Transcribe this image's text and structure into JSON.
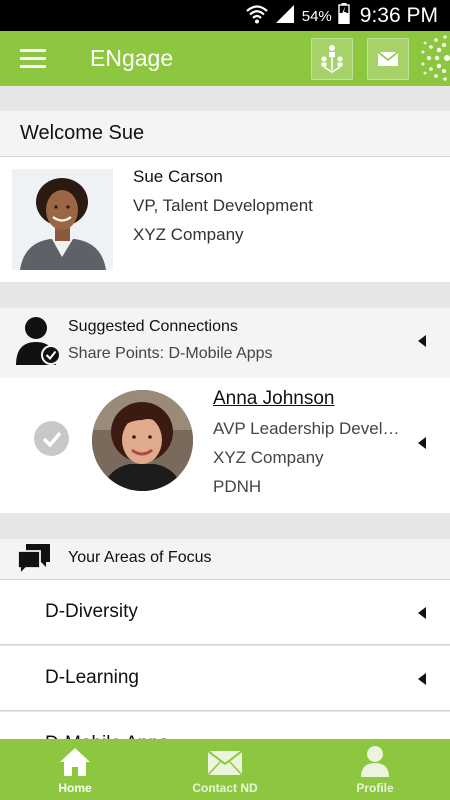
{
  "status_bar": {
    "battery": "54%",
    "time": "9:36 PM"
  },
  "app_bar": {
    "title": "ENgage"
  },
  "welcome": {
    "greeting": "Welcome Sue",
    "name": "Sue Carson",
    "title": "VP, Talent Development",
    "company": "XYZ Company"
  },
  "suggested": {
    "title": "Suggested Connections",
    "subtitle": "Share Points: D-Mobile Apps",
    "connection": {
      "name": "Anna Johnson",
      "title": "AVP Leadership Development",
      "company": "XYZ Company",
      "dept": "PDNH"
    }
  },
  "focus": {
    "title": "Your Areas of Focus",
    "items": [
      "D-Diversity",
      "D-Learning",
      "D-Mobile Apps"
    ]
  },
  "bottom_nav": {
    "home": "Home",
    "contact": "Contact ND",
    "profile": "Profile"
  },
  "colors": {
    "brand": "#8dc63f",
    "background": "#e6e6e6"
  }
}
